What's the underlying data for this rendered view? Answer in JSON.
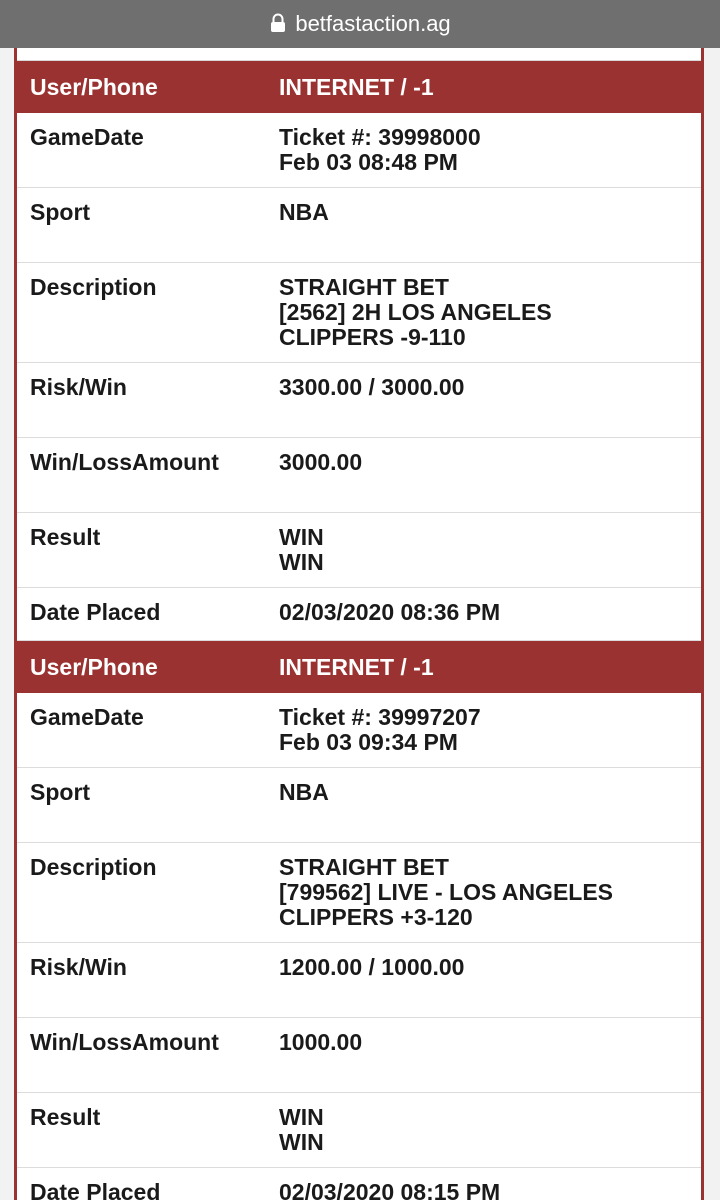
{
  "browser": {
    "url": "betfastaction.ag"
  },
  "tickets": [
    {
      "user_phone_label": "User/Phone",
      "user_phone_value": "INTERNET / -1",
      "gamedate_label": "GameDate",
      "ticket_line": "Ticket #: 39998000",
      "game_datetime": "Feb 03 08:48 PM",
      "sport_label": "Sport",
      "sport_value": "NBA",
      "description_label": "Description",
      "description_lines": [
        "STRAIGHT BET",
        "[2562] 2H LOS ANGELES",
        "CLIPPERS -9-110"
      ],
      "riskwin_label": "Risk/Win",
      "riskwin_value": "3300.00 / 3000.00",
      "winloss_label": "Win/LossAmount",
      "winloss_value": "3000.00",
      "result_label": "Result",
      "result_lines": [
        "WIN",
        "WIN"
      ],
      "placed_label": "Date Placed",
      "placed_value": "02/03/2020 08:36 PM"
    },
    {
      "user_phone_label": "User/Phone",
      "user_phone_value": "INTERNET / -1",
      "gamedate_label": "GameDate",
      "ticket_line": "Ticket #: 39997207",
      "game_datetime": "Feb 03 09:34 PM",
      "sport_label": "Sport",
      "sport_value": "NBA",
      "description_label": "Description",
      "description_lines": [
        "STRAIGHT BET",
        "[799562] LIVE - LOS ANGELES",
        "CLIPPERS +3-120"
      ],
      "riskwin_label": "Risk/Win",
      "riskwin_value": "1200.00 / 1000.00",
      "winloss_label": "Win/LossAmount",
      "winloss_value": "1000.00",
      "result_label": "Result",
      "result_lines": [
        "WIN",
        "WIN"
      ],
      "placed_label": "Date Placed",
      "placed_value": "02/03/2020 08:15 PM"
    }
  ],
  "colors": {
    "header_red": "#9b3232",
    "url_bar_gray": "#6f6f6f"
  }
}
